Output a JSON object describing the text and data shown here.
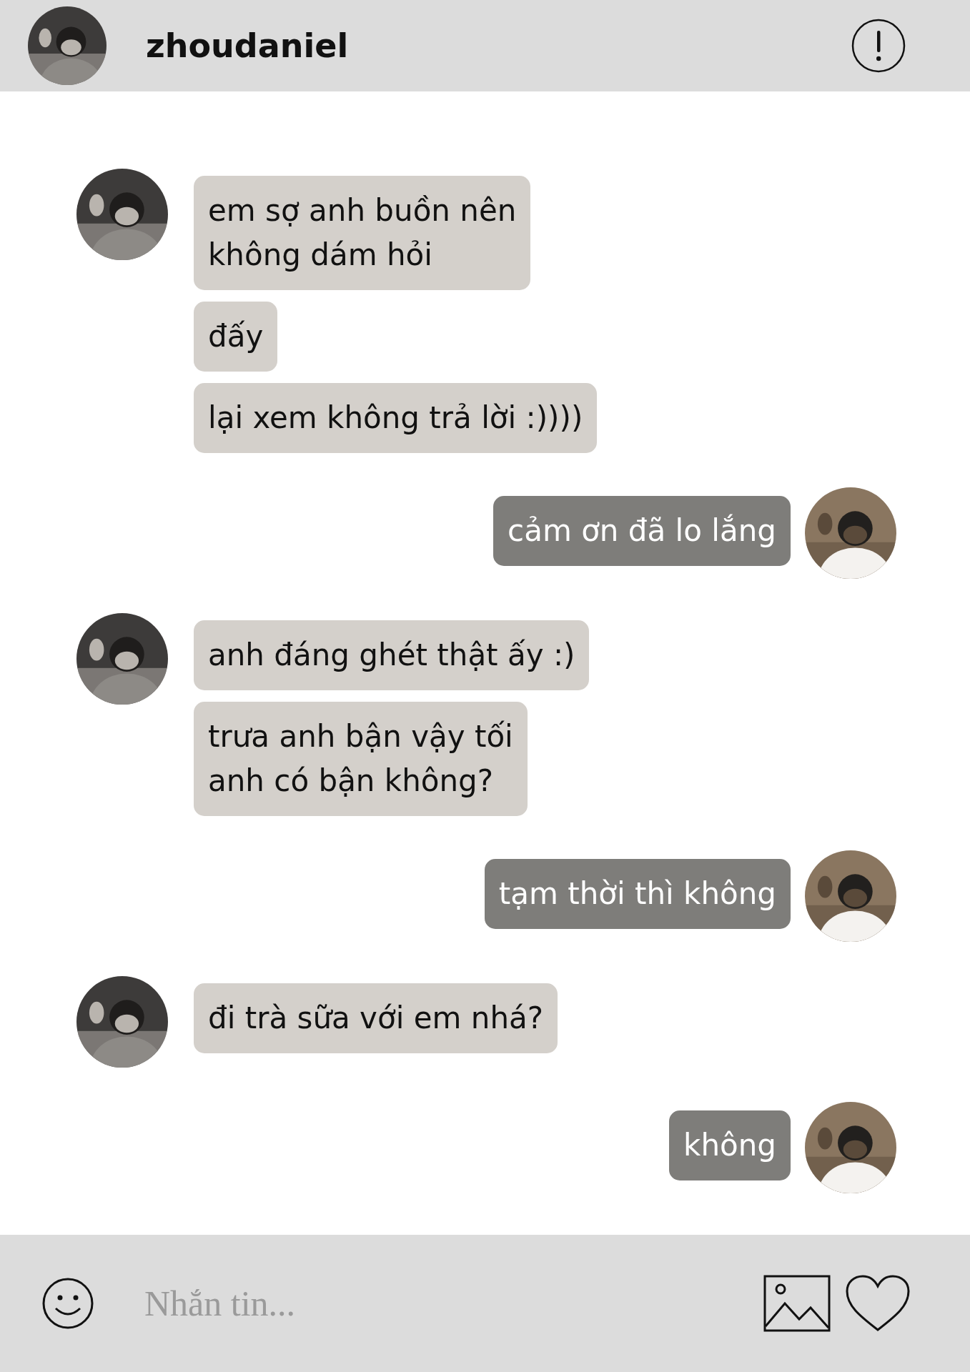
{
  "header": {
    "username": "zhoudaniel"
  },
  "messages": [
    {
      "kind": "them",
      "bubbles": [
        {
          "lines": [
            "em sợ anh buồn nên",
            "không dám hỏi"
          ]
        },
        {
          "lines": [
            "đấy"
          ]
        },
        {
          "lines": [
            "lại xem không trả lời :))))"
          ]
        }
      ]
    },
    {
      "kind": "me",
      "bubbles": [
        {
          "lines": [
            "cảm ơn đã lo lắng"
          ]
        }
      ]
    },
    {
      "kind": "them",
      "bubbles": [
        {
          "lines": [
            "anh đáng ghét thật ấy :)"
          ]
        },
        {
          "lines": [
            "trưa anh bận vậy tối",
            "anh có bận không?"
          ]
        }
      ]
    },
    {
      "kind": "me",
      "bubbles": [
        {
          "lines": [
            "tạm thời thì không"
          ]
        }
      ]
    },
    {
      "kind": "them",
      "bubbles": [
        {
          "lines": [
            "đi trà sữa với em nhá?"
          ]
        }
      ]
    },
    {
      "kind": "me",
      "bubbles": [
        {
          "lines": [
            "không"
          ]
        }
      ]
    }
  ],
  "composer": {
    "placeholder": "Nhắn tin..."
  }
}
